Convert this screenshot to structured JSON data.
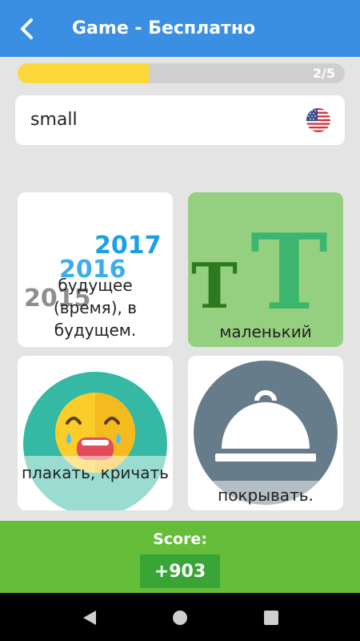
{
  "app_bar": {
    "title": "Game - Бесплатно",
    "back_icon": "chevron-left-icon"
  },
  "progress": {
    "label": "2/5",
    "current": 2,
    "total": 5,
    "fill_fraction": 0.4,
    "fill_color": "#fdd83a",
    "track_color": "#cfcfcf"
  },
  "question": {
    "word": "small",
    "language_icon": "us-flag-icon"
  },
  "answers": [
    {
      "label": "будущее (время), в будущем.",
      "image": "calendar-years-illustration",
      "image_text": [
        "2017",
        "2016",
        "2015"
      ]
    },
    {
      "label": "маленький",
      "image": "small-and-large-letter-t-illustration",
      "image_text": [
        "T",
        "T"
      ]
    },
    {
      "label": "плакать, кричать",
      "image": "crying-face-illustration"
    },
    {
      "label": "покрывать.",
      "image": "serving-cloche-illustration"
    }
  ],
  "score": {
    "title": "Score:",
    "value": "+903"
  },
  "nav": {
    "back_icon": "triangle-back-icon",
    "home_icon": "circle-home-icon",
    "recents_icon": "square-recents-icon"
  },
  "colors": {
    "app_bar": "#3a8fe3",
    "correct_tile": "#94d07f",
    "score_bar": "#64be3a",
    "score_box": "#3aa537"
  }
}
